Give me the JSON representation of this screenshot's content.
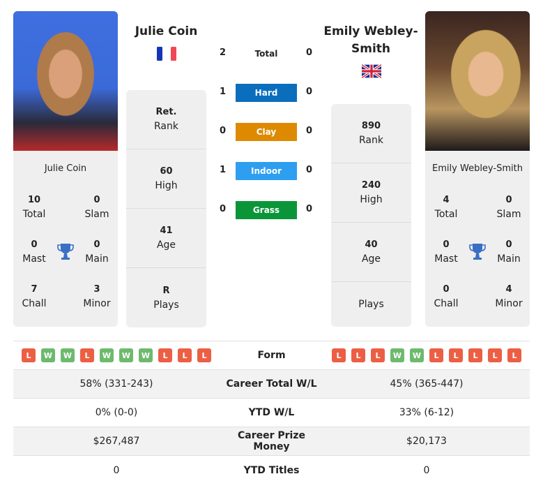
{
  "players": {
    "left": {
      "name": "Julie Coin",
      "country_flag": "france-flag",
      "card_name": "Julie Coin",
      "titles": {
        "total": {
          "value": "10",
          "label": "Total"
        },
        "slam": {
          "value": "0",
          "label": "Slam"
        },
        "mast": {
          "value": "0",
          "label": "Mast"
        },
        "main": {
          "value": "0",
          "label": "Main"
        },
        "chall": {
          "value": "7",
          "label": "Chall"
        },
        "minor": {
          "value": "3",
          "label": "Minor"
        }
      },
      "info": [
        {
          "value": "Ret.",
          "label": "Rank"
        },
        {
          "value": "60",
          "label": "High"
        },
        {
          "value": "41",
          "label": "Age"
        },
        {
          "value": "R",
          "label": "Plays"
        }
      ]
    },
    "right": {
      "name": "Emily Webley-Smith",
      "country_flag": "uk-flag",
      "card_name": "Emily Webley-Smith",
      "titles": {
        "total": {
          "value": "4",
          "label": "Total"
        },
        "slam": {
          "value": "0",
          "label": "Slam"
        },
        "mast": {
          "value": "0",
          "label": "Mast"
        },
        "main": {
          "value": "0",
          "label": "Main"
        },
        "chall": {
          "value": "0",
          "label": "Chall"
        },
        "minor": {
          "value": "4",
          "label": "Minor"
        }
      },
      "info": [
        {
          "value": "890",
          "label": "Rank"
        },
        {
          "value": "240",
          "label": "High"
        },
        {
          "value": "40",
          "label": "Age"
        },
        {
          "value": "",
          "label": "Plays"
        }
      ]
    }
  },
  "h2h": [
    {
      "surface": "Total",
      "left": "2",
      "right": "0",
      "color": ""
    },
    {
      "surface": "Hard",
      "left": "1",
      "right": "0",
      "color": "#0a6ebd"
    },
    {
      "surface": "Clay",
      "left": "0",
      "right": "0",
      "color": "#de8a00"
    },
    {
      "surface": "Indoor",
      "left": "1",
      "right": "0",
      "color": "#2d9ef0"
    },
    {
      "surface": "Grass",
      "left": "0",
      "right": "0",
      "color": "#0a9638"
    }
  ],
  "stats": {
    "form_label": "Form",
    "form_left": [
      "L",
      "W",
      "W",
      "L",
      "W",
      "W",
      "W",
      "L",
      "L",
      "L"
    ],
    "form_right": [
      "L",
      "L",
      "L",
      "W",
      "W",
      "L",
      "L",
      "L",
      "L",
      "L"
    ],
    "rows": [
      {
        "label": "Career Total W/L",
        "left": "58% (331-243)",
        "right": "45% (365-447)"
      },
      {
        "label": "YTD W/L",
        "left": "0% (0-0)",
        "right": "33% (6-12)"
      },
      {
        "label": "Career Prize Money",
        "left": "$267,487",
        "right": "$20,173"
      },
      {
        "label": "YTD Titles",
        "left": "0",
        "right": "0"
      }
    ]
  },
  "colors": {
    "win": "#6dba6d",
    "loss": "#ec5f44",
    "trophy": "#3a6fc4",
    "card_bg": "#efefef"
  }
}
